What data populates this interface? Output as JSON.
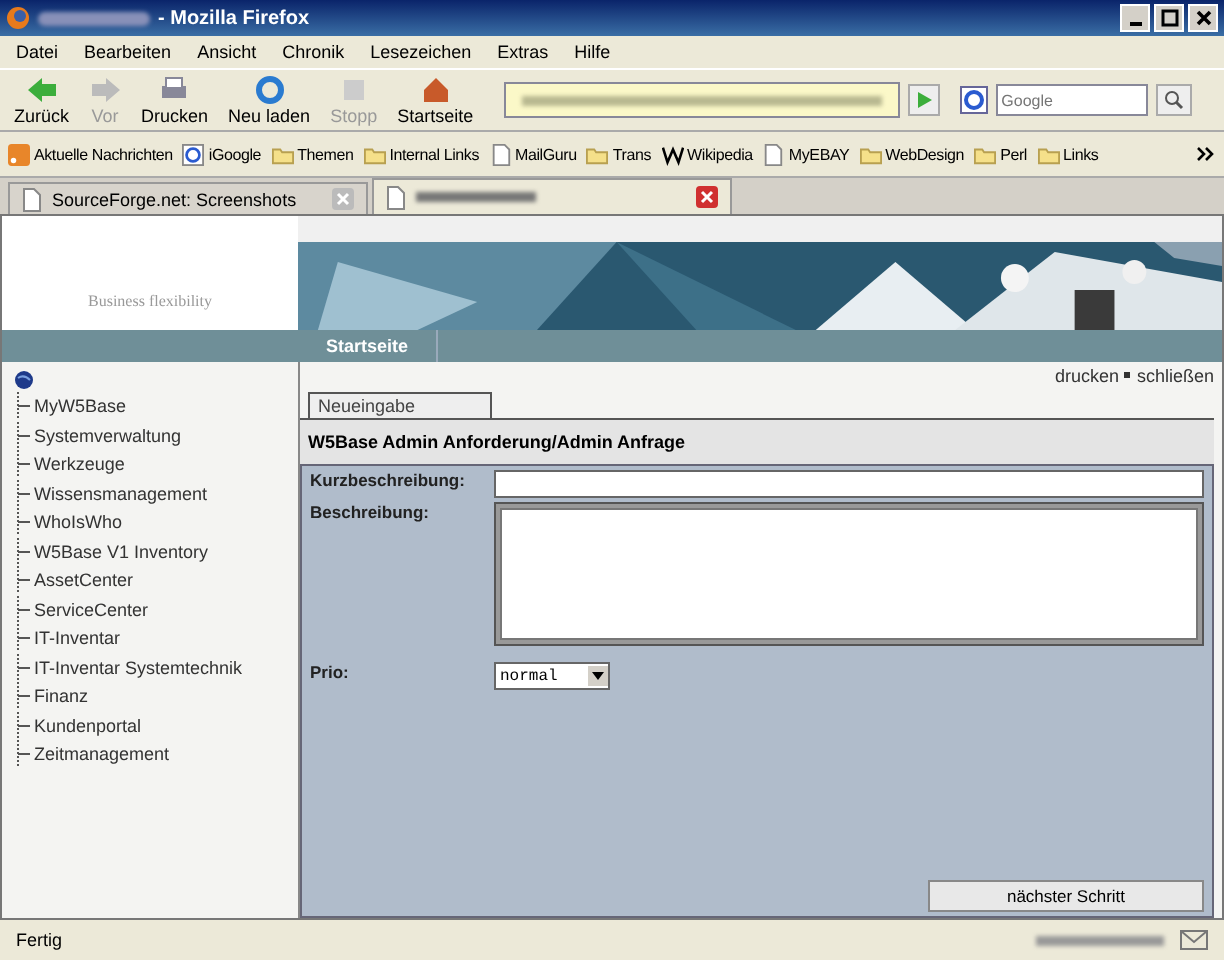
{
  "window": {
    "title": "- Mozilla Firefox"
  },
  "menu": [
    "Datei",
    "Bearbeiten",
    "Ansicht",
    "Chronik",
    "Lesezeichen",
    "Extras",
    "Hilfe"
  ],
  "toolbar": [
    {
      "label": "Zurück",
      "kind": "back",
      "disabled": false
    },
    {
      "label": "Vor",
      "kind": "forward",
      "disabled": true
    },
    {
      "label": "Drucken",
      "kind": "print",
      "disabled": false
    },
    {
      "label": "Neu laden",
      "kind": "reload",
      "disabled": false
    },
    {
      "label": "Stopp",
      "kind": "stop",
      "disabled": true
    },
    {
      "label": "Startseite",
      "kind": "home",
      "disabled": false
    }
  ],
  "search": {
    "placeholder": "Google"
  },
  "bookmarks": [
    {
      "label": "Aktuelle Nachrichten",
      "kind": "feed"
    },
    {
      "label": "iGoogle",
      "kind": "google"
    },
    {
      "label": "Themen",
      "kind": "folder"
    },
    {
      "label": "Internal Links",
      "kind": "folder"
    },
    {
      "label": "MailGuru",
      "kind": "page"
    },
    {
      "label": "Trans",
      "kind": "folder"
    },
    {
      "label": "Wikipedia",
      "kind": "wiki"
    },
    {
      "label": "MyEBAY",
      "kind": "page"
    },
    {
      "label": "WebDesign",
      "kind": "folder"
    },
    {
      "label": "Perl",
      "kind": "folder"
    },
    {
      "label": "Links",
      "kind": "folder"
    }
  ],
  "tabs": [
    {
      "label": "SourceForge.net: Screenshots",
      "selected": false
    },
    {
      "selected": true
    }
  ],
  "site": {
    "tagline": "Business flexibility",
    "nav_tab": "Startseite",
    "links": [
      "drucken",
      "schließen"
    ]
  },
  "sidebar": {
    "items": [
      "MyW5Base",
      "Systemverwaltung",
      "Werkzeuge",
      "Wissensmanagement",
      "WhoIsWho",
      "W5Base V1 Inventory",
      "AssetCenter",
      "ServiceCenter",
      "IT-Inventar",
      "IT-Inventar Systemtechnik",
      "Finanz",
      "Kundenportal",
      "Zeitmanagement"
    ]
  },
  "form": {
    "tab": "Neueingabe",
    "title": "W5Base Admin Anforderung/Admin Anfrage",
    "fields": [
      {
        "label": "Kurzbeschreibung:",
        "kind": "text"
      },
      {
        "label": "Beschreibung:",
        "kind": "textarea"
      },
      {
        "label": "Prio:",
        "kind": "select",
        "value": "normal"
      }
    ],
    "button": "nächster Schritt"
  },
  "status_bar": {
    "text": "Fertig"
  }
}
